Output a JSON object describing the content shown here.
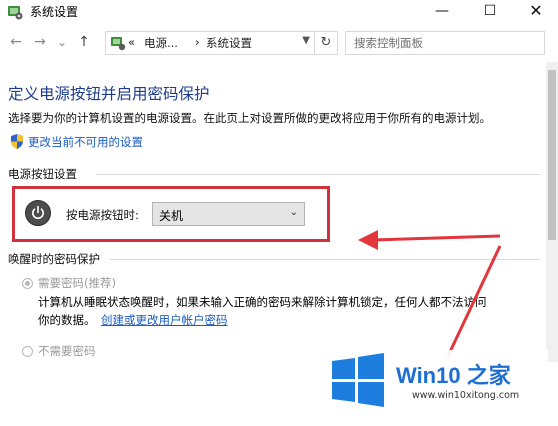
{
  "window": {
    "title": "系统设置",
    "controls": {
      "minimize": "—",
      "maximize": "☐",
      "close": "✕"
    }
  },
  "nav": {
    "back": "←",
    "forward": "→",
    "recent": "⌄",
    "up": "↑",
    "breadcrumb_prefix": "«",
    "breadcrumbs": [
      "电源...",
      "系统设置"
    ],
    "separator": "›",
    "search_placeholder": "搜索控制面板"
  },
  "page": {
    "heading": "定义电源按钮并启用密码保护",
    "description": "选择要为你的计算机设置的电源设置。在此页上对设置所做的更改将应用于你所有的电源计划。",
    "change_settings_link": "更改当前不可用的设置",
    "power_section": {
      "title": "电源按钮设置",
      "label": "按电源按钮时:",
      "selected": "关机"
    },
    "wake_section": {
      "title": "唤醒时的密码保护",
      "require_password": "需要密码(推荐)",
      "require_desc_line1": "计算机从睡眠状态唤醒时，如果未输入正确的密码来解除计算机锁定，任何人都不法访问",
      "require_desc_line2": "你的数据。",
      "create_password_link": "创建或更改用户帐户密码",
      "no_password": "不需要密码"
    }
  },
  "watermark": {
    "title": "Win10 之家",
    "url": "www.win10xitong.com"
  },
  "colors": {
    "heading": "#1c3c8d",
    "link": "#1a5bc1",
    "annotation": "#d0333b",
    "watermark": "#1d6fd1"
  }
}
